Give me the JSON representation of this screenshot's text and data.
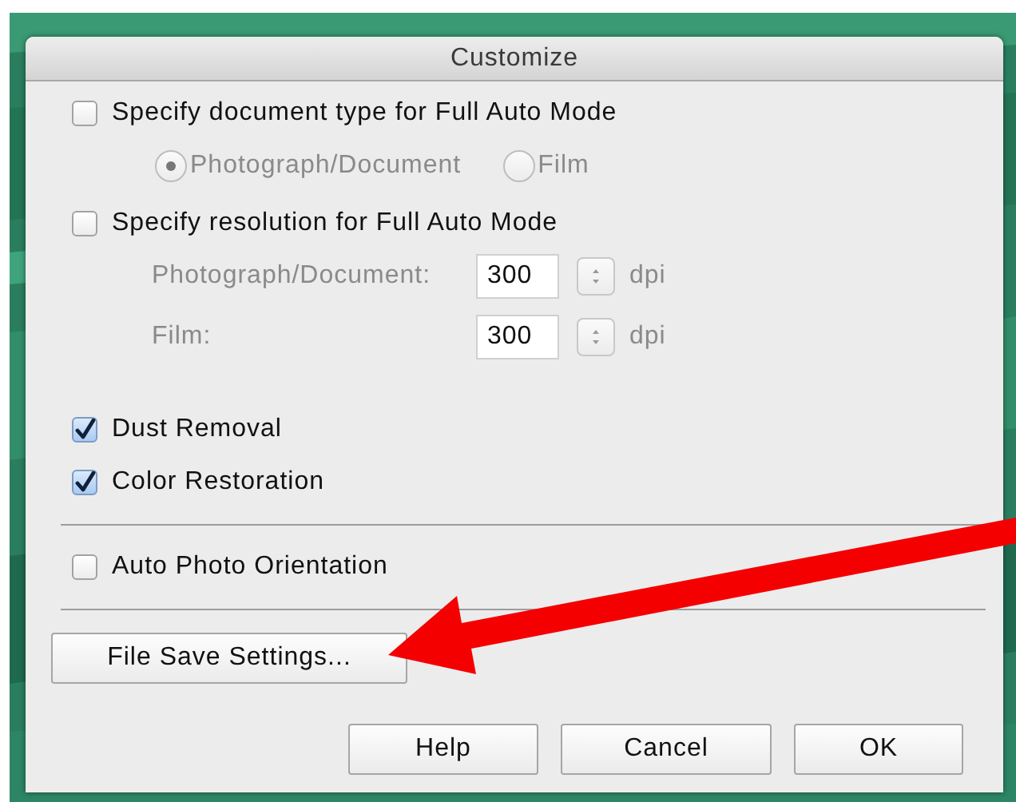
{
  "window": {
    "title": "Customize"
  },
  "document_type": {
    "label": "Specify document type for Full Auto Mode",
    "checked": false,
    "disabled": true,
    "radios": [
      {
        "label": "Photograph/Document",
        "selected": true
      },
      {
        "label": "Film",
        "selected": false
      }
    ]
  },
  "resolution": {
    "label": "Specify resolution for Full Auto Mode",
    "checked": false,
    "disabled": true,
    "fields": [
      {
        "label": "Photograph/Document:",
        "value": "300",
        "unit": "dpi"
      },
      {
        "label": "Film:",
        "value": "300",
        "unit": "dpi"
      }
    ]
  },
  "corrections": [
    {
      "label": "Dust Removal",
      "checked": true
    },
    {
      "label": "Color Restoration",
      "checked": true
    }
  ],
  "orientation": {
    "label": "Auto Photo Orientation",
    "checked": false
  },
  "file_save_button": "File Save Settings...",
  "buttons": [
    "Help",
    "Cancel",
    "OK"
  ]
}
